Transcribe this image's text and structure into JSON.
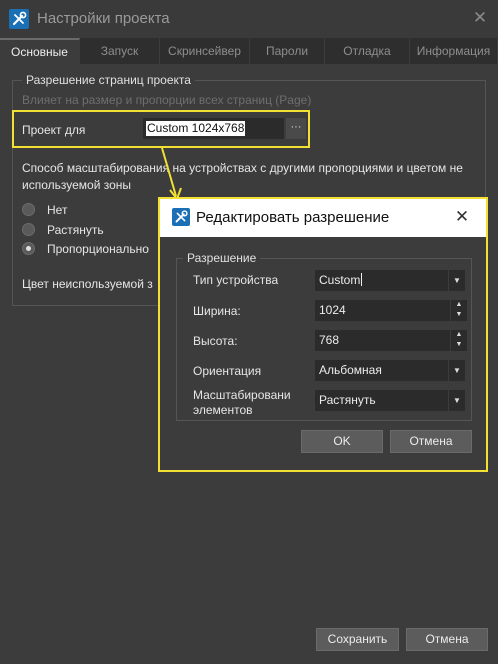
{
  "window": {
    "title": "Настройки проекта",
    "close_glyph": "✕"
  },
  "tabs": [
    {
      "label": "Основные",
      "active": true
    },
    {
      "label": "Запуск"
    },
    {
      "label": "Скринсейвер"
    },
    {
      "label": "Пароли"
    },
    {
      "label": "Отладка"
    },
    {
      "label": "Информация"
    }
  ],
  "resolution_group": {
    "legend": "Разрешение страниц проекта",
    "hint": "Влияет на размер и пропорции всех страниц (Page)",
    "project_for_label": "Проект для",
    "project_value": "Custom 1024x768",
    "browse_label": "···"
  },
  "scaling": {
    "description": "Способ масштабирования на устройствах с другими пропорциями и цветом не используемой зоны",
    "options": [
      {
        "label": "Нет",
        "checked": false
      },
      {
        "label": "Растянуть",
        "checked": false
      },
      {
        "label": "Пропорционально",
        "checked": true
      }
    ],
    "unused_color_label": "Цвет неиспользуемой з"
  },
  "dialog": {
    "title": "Редактировать разрешение",
    "close_glyph": "✕",
    "group_legend": "Разрешение",
    "device_type_label": "Тип устройства",
    "device_type_value": "Custom",
    "width_label": "Ширина:",
    "width_value": "1024",
    "height_label": "Высота:",
    "height_value": "768",
    "orientation_label": "Ориентация",
    "orientation_value": "Альбомная",
    "scaling_label": "Масштабировани элементов",
    "scaling_value": "Растянуть",
    "ok_label": "OK",
    "cancel_label": "Отмена"
  },
  "footer": {
    "save_label": "Сохранить",
    "cancel_label": "Отмена"
  },
  "colors": {
    "highlight": "#f2e033",
    "window_bg": "#3c3c3c",
    "accent_icon": "#1a6fb5"
  }
}
